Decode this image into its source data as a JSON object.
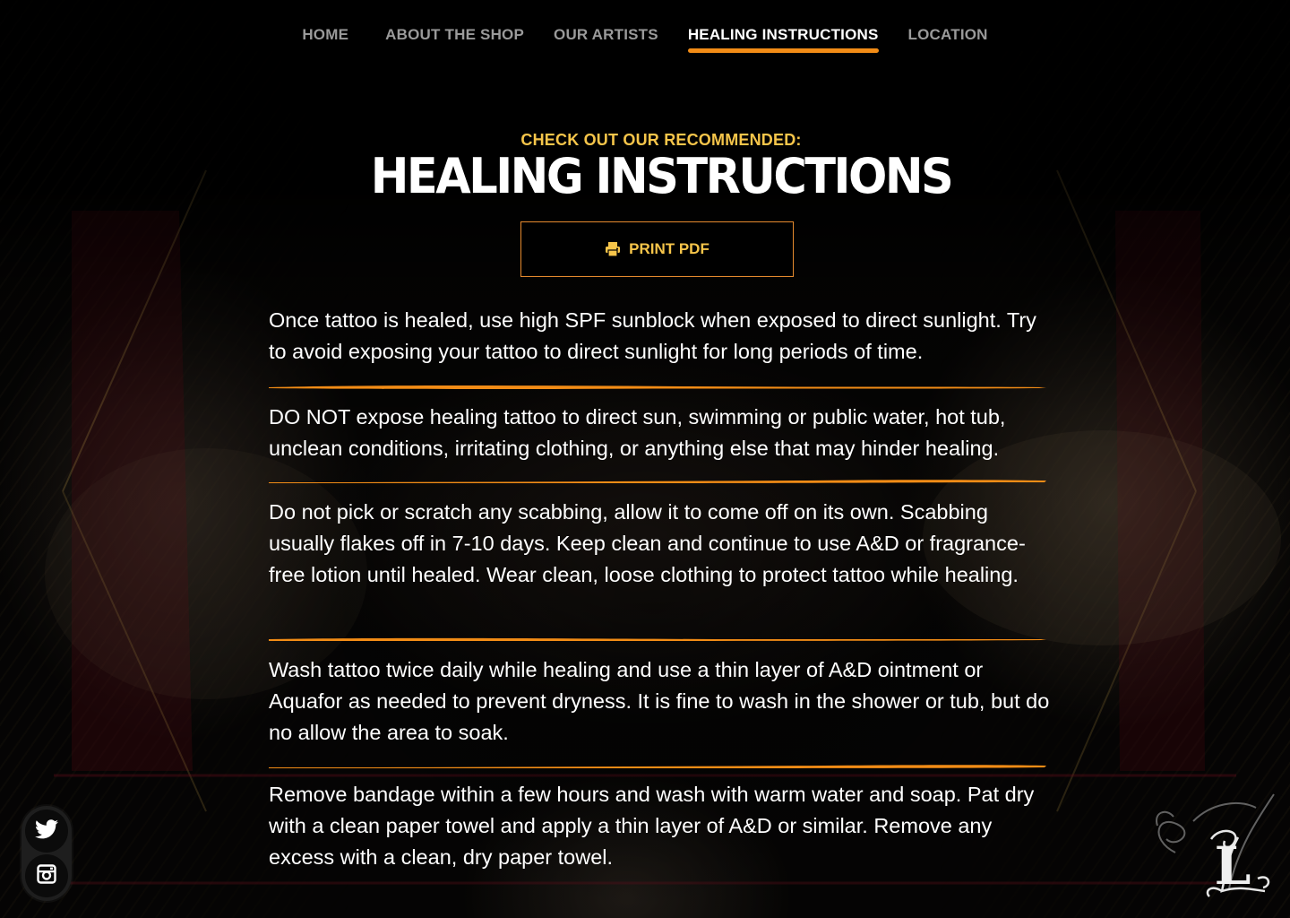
{
  "nav": {
    "items": [
      {
        "label": "HOME"
      },
      {
        "label": "ABOUT THE SHOP"
      },
      {
        "label": "OUR ARTISTS"
      },
      {
        "label": "HEALING INSTRUCTIONS",
        "active": true
      },
      {
        "label": "LOCATION"
      }
    ]
  },
  "header": {
    "eyebrow": "CHECK OUT OUR RECOMMENDED:",
    "title": "HEALING INSTRUCTIONS",
    "print_label": "PRINT PDF",
    "print_icon": "printer-icon"
  },
  "instructions": [
    "Once tattoo is healed, use high SPF sunblock when exposed to direct sunlight. Try to avoid exposing your tattoo to direct sunlight for long periods of time.",
    "DO NOT expose healing tattoo to direct sun, swimming or public water, hot tub, unclean conditions, irritating clothing, or anything else that may hinder healing.",
    "Do not pick or scratch any scabbing, allow it to come off on its own. Scabbing usually flakes off in 7-10 days. Keep clean and continue to use A&D or fragrance-free lotion until healed. Wear clean, loose clothing to protect tattoo while healing.",
    "Wash tattoo twice daily while healing and use a thin layer of A&D ointment or Aquafor as needed to prevent dryness. It is fine to wash in the shower or tub, but do no allow the area to soak.",
    "Remove bandage within a few hours and wash with warm water and soap. Pat dry with a clean paper towel and apply a thin layer of A&D or similar. Remove any excess with a clean, dry paper towel."
  ],
  "social": {
    "items": [
      {
        "icon": "twitter-icon"
      },
      {
        "icon": "instagram-icon"
      }
    ]
  },
  "logo": {
    "mark": "L"
  },
  "colors": {
    "accent": "#f28c16",
    "eyebrow": "#f6c54a",
    "nav_inactive": "#9a9a9a",
    "background": "#070605"
  }
}
